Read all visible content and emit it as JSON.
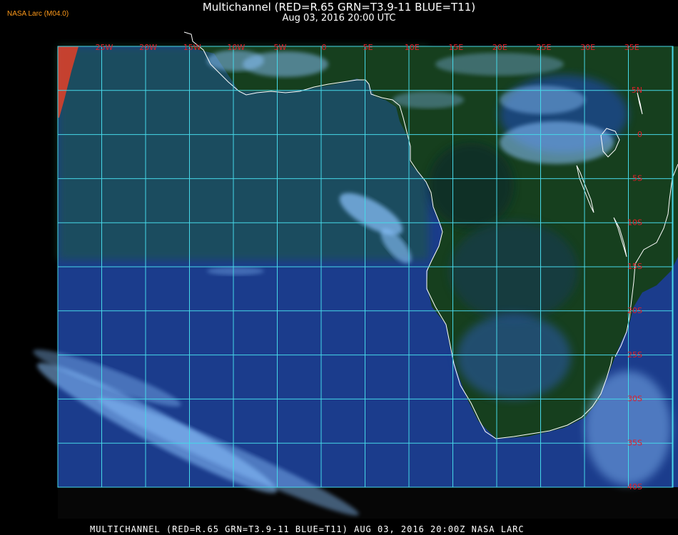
{
  "source_label": "NASA Larc (M04.0)",
  "title": "Multichannel (RED=R.65 GRN=T3.9-11 BLUE=T11)",
  "subtitle": "Aug 03, 2016 20:00 UTC",
  "footer": "MULTICHANNEL (RED=R.65 GRN=T3.9-11 BLUE=T11) AUG 03, 2016 20:00Z   NASA LARC",
  "colors": {
    "grid": "#46d8e8",
    "labels": "#e0202a",
    "coast": "#ffffff",
    "land": "#123e1a",
    "ocean": "#1a3f9a",
    "cloud": "#7ab2f2"
  },
  "longitude_labels": [
    "25W",
    "20W",
    "15W",
    "10W",
    "5W",
    "0",
    "5E",
    "10E",
    "15E",
    "20E",
    "25E",
    "30E",
    "35E"
  ],
  "latitude_labels": [
    "5N",
    "0",
    "5S",
    "10S",
    "15S",
    "20S",
    "25S",
    "30S",
    "35S",
    "40S"
  ]
}
